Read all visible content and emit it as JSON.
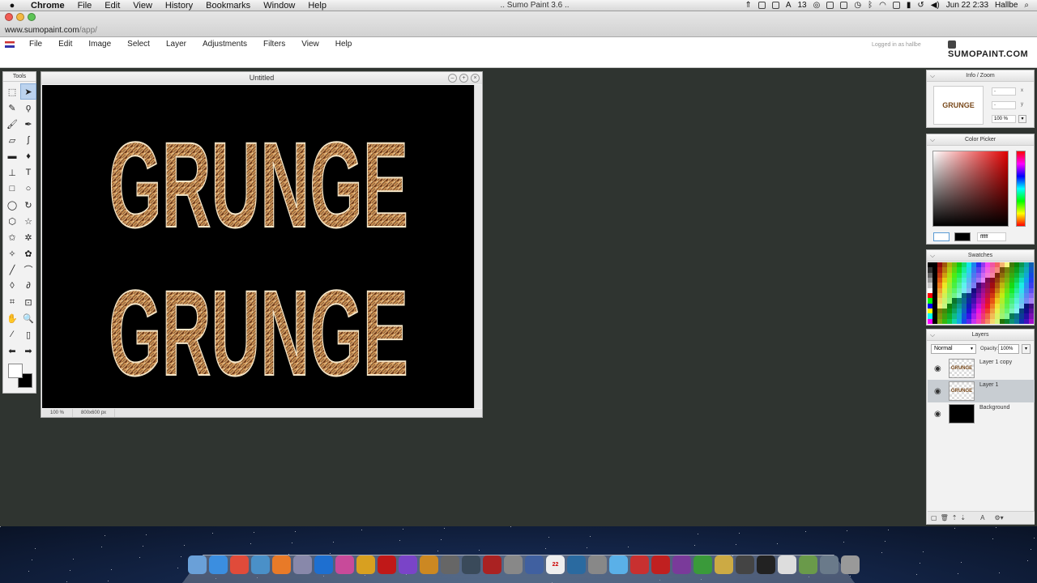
{
  "mac_menubar": {
    "app": "Chrome",
    "items": [
      "File",
      "Edit",
      "View",
      "History",
      "Bookmarks",
      "Window",
      "Help"
    ],
    "window_title": ".. Sumo Paint 3.6 ..",
    "status": {
      "battery_count": "13",
      "clock": "Jun 22  2:33",
      "user": "Hallbe"
    }
  },
  "browser": {
    "url_host": "www.sumopaint.com",
    "url_path": "/app/"
  },
  "sumo": {
    "menu": [
      "File",
      "Edit",
      "Image",
      "Select",
      "Layer",
      "Adjustments",
      "Filters",
      "View",
      "Help"
    ],
    "logged_in": "Logged in as hallbe",
    "logo": "SUMOPAINT.COM"
  },
  "tools": {
    "title": "Tools",
    "items": [
      {
        "name": "marquee-tool",
        "glyph": "⬚"
      },
      {
        "name": "move-tool",
        "glyph": "➤"
      },
      {
        "name": "pencil-tool",
        "glyph": "✎"
      },
      {
        "name": "lasso-tool",
        "glyph": "ϙ"
      },
      {
        "name": "brush-tool",
        "glyph": "🖌"
      },
      {
        "name": "ink-tool",
        "glyph": "✒"
      },
      {
        "name": "eraser-tool",
        "glyph": "▱"
      },
      {
        "name": "smudge-tool",
        "glyph": "∫"
      },
      {
        "name": "gradient-tool",
        "glyph": "▬"
      },
      {
        "name": "bucket-tool",
        "glyph": "♦"
      },
      {
        "name": "stamp-tool",
        "glyph": "⊥"
      },
      {
        "name": "text-tool",
        "glyph": "T"
      },
      {
        "name": "rectangle-tool",
        "glyph": "□"
      },
      {
        "name": "ellipse-tool",
        "glyph": "○"
      },
      {
        "name": "circle-tool",
        "glyph": "◯"
      },
      {
        "name": "spiral-tool",
        "glyph": "↻"
      },
      {
        "name": "hexagon-tool",
        "glyph": "⬡"
      },
      {
        "name": "star-tool",
        "glyph": "☆"
      },
      {
        "name": "star2-tool",
        "glyph": "✩"
      },
      {
        "name": "burst-tool",
        "glyph": "✲"
      },
      {
        "name": "star3-tool",
        "glyph": "✧"
      },
      {
        "name": "flower-tool",
        "glyph": "✿"
      },
      {
        "name": "line-tool",
        "glyph": "╱"
      },
      {
        "name": "curve-tool",
        "glyph": "⌒"
      },
      {
        "name": "blur-tool",
        "glyph": "◊"
      },
      {
        "name": "dodge-tool",
        "glyph": "∂"
      },
      {
        "name": "crop-tool",
        "glyph": "⌗"
      },
      {
        "name": "transform-tool",
        "glyph": "⊡"
      },
      {
        "name": "hand-tool",
        "glyph": "✋"
      },
      {
        "name": "zoom-tool",
        "glyph": "🔍"
      },
      {
        "name": "eyedropper-tool",
        "glyph": "⁄"
      },
      {
        "name": "clone-tool",
        "glyph": "▯"
      },
      {
        "name": "undo-arrow",
        "glyph": "⬅"
      },
      {
        "name": "redo-arrow",
        "glyph": "➡"
      }
    ]
  },
  "document": {
    "title": "Untitled",
    "zoom": "100 %",
    "size": "800x600 px",
    "text_top": "GRUNGE",
    "text_bottom": "GRUNGE"
  },
  "info_zoom": {
    "title": "Info / Zoom",
    "thumb_text": "GRUNGE",
    "x_value": "-",
    "x_label": "x",
    "y_value": "-",
    "y_label": "y",
    "zoom": "100 %"
  },
  "color_picker": {
    "title": "Color Picker",
    "hex": "ffffff"
  },
  "swatches": {
    "title": "Swatches"
  },
  "layers": {
    "title": "Layers",
    "blend_mode": "Normal",
    "opacity_label": "Opacity:",
    "opacity": "100%",
    "items": [
      {
        "name": "Layer 1 copy",
        "thumb": "GRUNGE"
      },
      {
        "name": "Layer 1",
        "thumb": "GRUNGE"
      },
      {
        "name": "Background",
        "thumb": ""
      }
    ]
  },
  "dock": {
    "calendar_day": "22",
    "icons": [
      "finder",
      "appstore",
      "chrome",
      "safari",
      "firefox",
      "preview",
      "ps",
      "picasa",
      "pages",
      "acrobat",
      "itunes",
      "guitar",
      "gamecenter",
      "lightroom",
      "photobooth",
      "bootcamp",
      "directory",
      "calendar",
      "timemachine",
      "system",
      "snow",
      "angry",
      "flash",
      "eclipse",
      "dreamweaver",
      "shadow",
      "movie",
      "piano",
      "keyboard",
      "photos",
      "network",
      "trash"
    ]
  }
}
